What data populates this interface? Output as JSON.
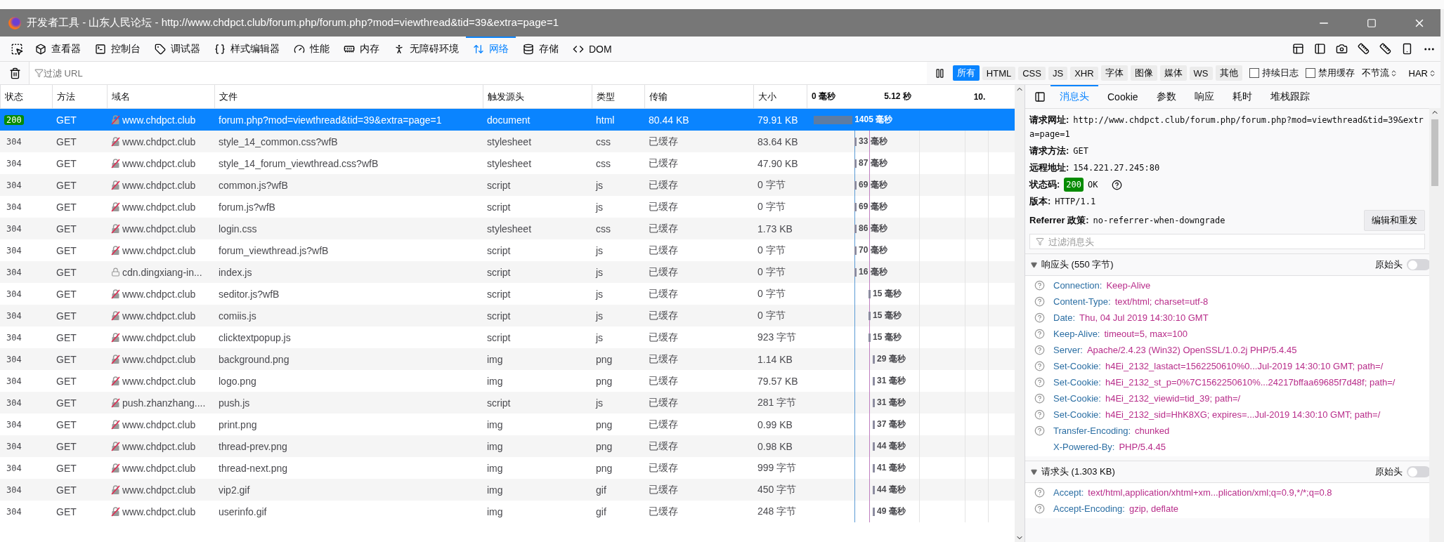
{
  "window": {
    "title": "开发者工具 - 山东人民论坛 - http://www.chdpct.club/forum.php/forum.php?mod=viewthread&tid=39&extra=page=1"
  },
  "tools": [
    {
      "label": "查看器",
      "kind": "inspector",
      "selected": false
    },
    {
      "label": "控制台",
      "kind": "console",
      "selected": false
    },
    {
      "label": "调试器",
      "kind": "debugger",
      "selected": false
    },
    {
      "label": "样式编辑器",
      "kind": "style",
      "selected": false
    },
    {
      "label": "性能",
      "kind": "performance",
      "selected": false
    },
    {
      "label": "内存",
      "kind": "memory",
      "selected": false
    },
    {
      "label": "无障碍环境",
      "kind": "accessibility",
      "selected": false
    },
    {
      "label": "网络",
      "kind": "network",
      "selected": true
    },
    {
      "label": "存储",
      "kind": "storage",
      "selected": false
    },
    {
      "label": "DOM",
      "kind": "dom",
      "selected": false
    }
  ],
  "filter": {
    "placeholder": "过滤 URL"
  },
  "type_filters": [
    {
      "label": "所有",
      "selected": true
    },
    {
      "label": "HTML",
      "selected": false
    },
    {
      "label": "CSS",
      "selected": false
    },
    {
      "label": "JS",
      "selected": false
    },
    {
      "label": "XHR",
      "selected": false
    },
    {
      "label": "字体",
      "selected": false
    },
    {
      "label": "图像",
      "selected": false
    },
    {
      "label": "媒体",
      "selected": false
    },
    {
      "label": "WS",
      "selected": false
    },
    {
      "label": "其他",
      "selected": false
    }
  ],
  "options": [
    {
      "label": "持续日志",
      "checked": false
    },
    {
      "label": "禁用缓存",
      "checked": false
    }
  ],
  "selects": [
    "不节流",
    "HAR"
  ],
  "columns": [
    "状态",
    "方法",
    "域名",
    "文件",
    "触发源头",
    "类型",
    "传输",
    "大小"
  ],
  "timeline_ticks": [
    "0 毫秒",
    "5.12 秒",
    "10."
  ],
  "rows": [
    {
      "status": "200",
      "method": "GET",
      "secure": false,
      "domain": "www.chdpct.club",
      "file": "forum.php?mod=viewthread&tid=39&extra=page=1",
      "cause": "document",
      "type": "html",
      "transferred": "80.44 KB",
      "size": "79.91 KB",
      "time": "1405 毫秒",
      "selected": true
    },
    {
      "status": "304",
      "method": "GET",
      "secure": false,
      "domain": "www.chdpct.club",
      "file": "style_14_common.css?wfB",
      "cause": "stylesheet",
      "type": "css",
      "transferred": "已缓存",
      "size": "83.64 KB",
      "time": "33 毫秒",
      "selected": false
    },
    {
      "status": "304",
      "method": "GET",
      "secure": false,
      "domain": "www.chdpct.club",
      "file": "style_14_forum_viewthread.css?wfB",
      "cause": "stylesheet",
      "type": "css",
      "transferred": "已缓存",
      "size": "47.90 KB",
      "time": "87 毫秒",
      "selected": false
    },
    {
      "status": "304",
      "method": "GET",
      "secure": false,
      "domain": "www.chdpct.club",
      "file": "common.js?wfB",
      "cause": "script",
      "type": "js",
      "transferred": "已缓存",
      "size": "0 字节",
      "time": "69 毫秒",
      "selected": false
    },
    {
      "status": "304",
      "method": "GET",
      "secure": false,
      "domain": "www.chdpct.club",
      "file": "forum.js?wfB",
      "cause": "script",
      "type": "js",
      "transferred": "已缓存",
      "size": "0 字节",
      "time": "69 毫秒",
      "selected": false
    },
    {
      "status": "304",
      "method": "GET",
      "secure": false,
      "domain": "www.chdpct.club",
      "file": "login.css",
      "cause": "stylesheet",
      "type": "css",
      "transferred": "已缓存",
      "size": "1.73 KB",
      "time": "86 毫秒",
      "selected": false
    },
    {
      "status": "304",
      "method": "GET",
      "secure": false,
      "domain": "www.chdpct.club",
      "file": "forum_viewthread.js?wfB",
      "cause": "script",
      "type": "js",
      "transferred": "已缓存",
      "size": "0 字节",
      "time": "70 毫秒",
      "selected": false
    },
    {
      "status": "304",
      "method": "GET",
      "secure": true,
      "domain": "cdn.dingxiang-in...",
      "file": "index.js",
      "cause": "script",
      "type": "js",
      "transferred": "已缓存",
      "size": "0 字节",
      "time": "16 毫秒",
      "selected": false
    },
    {
      "status": "304",
      "method": "GET",
      "secure": false,
      "domain": "www.chdpct.club",
      "file": "seditor.js?wfB",
      "cause": "script",
      "type": "js",
      "transferred": "已缓存",
      "size": "0 字节",
      "time": "15 毫秒",
      "selected": false
    },
    {
      "status": "304",
      "method": "GET",
      "secure": false,
      "domain": "www.chdpct.club",
      "file": "comiis.js",
      "cause": "script",
      "type": "js",
      "transferred": "已缓存",
      "size": "0 字节",
      "time": "15 毫秒",
      "selected": false
    },
    {
      "status": "304",
      "method": "GET",
      "secure": false,
      "domain": "www.chdpct.club",
      "file": "clicktextpopup.js",
      "cause": "script",
      "type": "js",
      "transferred": "已缓存",
      "size": "923 字节",
      "time": "15 毫秒",
      "selected": false
    },
    {
      "status": "304",
      "method": "GET",
      "secure": false,
      "domain": "www.chdpct.club",
      "file": "background.png",
      "cause": "img",
      "type": "png",
      "transferred": "已缓存",
      "size": "1.14 KB",
      "time": "29 毫秒",
      "selected": false
    },
    {
      "status": "304",
      "method": "GET",
      "secure": false,
      "domain": "www.chdpct.club",
      "file": "logo.png",
      "cause": "img",
      "type": "png",
      "transferred": "已缓存",
      "size": "79.57 KB",
      "time": "31 毫秒",
      "selected": false
    },
    {
      "status": "304",
      "method": "GET",
      "secure": false,
      "domain": "push.zhanzhang....",
      "file": "push.js",
      "cause": "script",
      "type": "js",
      "transferred": "已缓存",
      "size": "281 字节",
      "time": "31 毫秒",
      "selected": false
    },
    {
      "status": "304",
      "method": "GET",
      "secure": false,
      "domain": "www.chdpct.club",
      "file": "print.png",
      "cause": "img",
      "type": "png",
      "transferred": "已缓存",
      "size": "0.99 KB",
      "time": "37 毫秒",
      "selected": false
    },
    {
      "status": "304",
      "method": "GET",
      "secure": false,
      "domain": "www.chdpct.club",
      "file": "thread-prev.png",
      "cause": "img",
      "type": "png",
      "transferred": "已缓存",
      "size": "0.98 KB",
      "time": "44 毫秒",
      "selected": false
    },
    {
      "status": "304",
      "method": "GET",
      "secure": false,
      "domain": "www.chdpct.club",
      "file": "thread-next.png",
      "cause": "img",
      "type": "png",
      "transferred": "已缓存",
      "size": "999 字节",
      "time": "41 毫秒",
      "selected": false
    },
    {
      "status": "304",
      "method": "GET",
      "secure": false,
      "domain": "www.chdpct.club",
      "file": "vip2.gif",
      "cause": "img",
      "type": "gif",
      "transferred": "已缓存",
      "size": "450 字节",
      "time": "44 毫秒",
      "selected": false
    },
    {
      "status": "304",
      "method": "GET",
      "secure": false,
      "domain": "www.chdpct.club",
      "file": "userinfo.gif",
      "cause": "img",
      "type": "gif",
      "transferred": "已缓存",
      "size": "248 字节",
      "time": "49 毫秒",
      "selected": false
    }
  ],
  "details": {
    "tabs": [
      {
        "label": "消息头",
        "selected": true
      },
      {
        "label": "Cookie",
        "selected": false
      },
      {
        "label": "参数",
        "selected": false
      },
      {
        "label": "响应",
        "selected": false
      },
      {
        "label": "耗时",
        "selected": false
      },
      {
        "label": "堆栈跟踪",
        "selected": false
      }
    ],
    "summary": [
      {
        "label": "请求网址:",
        "value": "http://www.chdpct.club/forum.php/forum.php?mod=viewthread&tid=39&extra=page=1"
      },
      {
        "label": "请求方法:",
        "value": "GET"
      },
      {
        "label": "远程地址:",
        "value": "154.221.27.245:80"
      }
    ],
    "status": {
      "label": "状态码:",
      "code": "200",
      "text": "OK"
    },
    "version": {
      "label": "版本:",
      "value": "HTTP/1.1"
    },
    "referrer": {
      "label": "Referrer 政策:",
      "value": "no-referrer-when-downgrade"
    },
    "resend_button": "编辑和重发",
    "header_filter": {
      "placeholder": "过滤消息头"
    },
    "sections": [
      {
        "title": "响应头 (550 字节)",
        "expanded": true,
        "raw_label": "原始头",
        "raw_on": false,
        "headers": [
          {
            "name": "Connection:",
            "value": "Keep-Alive",
            "help": true
          },
          {
            "name": "Content-Type:",
            "value": "text/html; charset=utf-8",
            "help": true
          },
          {
            "name": "Date:",
            "value": "Thu, 04 Jul 2019 14:30:10 GMT",
            "help": true
          },
          {
            "name": "Keep-Alive:",
            "value": "timeout=5, max=100",
            "help": true
          },
          {
            "name": "Server:",
            "value": "Apache/2.4.23 (Win32) OpenSSL/1.0.2j PHP/5.4.45",
            "help": true
          },
          {
            "name": "Set-Cookie:",
            "value": "h4Ei_2132_lastact=1562250610%0...Jul-2019 14:30:10 GMT; path=/",
            "help": true
          },
          {
            "name": "Set-Cookie:",
            "value": "h4Ei_2132_st_p=0%7C1562250610%...24217bffaa69685f7d48f; path=/",
            "help": true
          },
          {
            "name": "Set-Cookie:",
            "value": "h4Ei_2132_viewid=tid_39; path=/",
            "help": true
          },
          {
            "name": "Set-Cookie:",
            "value": "h4Ei_2132_sid=HhK8XG; expires=...Jul-2019 14:30:10 GMT; path=/",
            "help": true
          },
          {
            "name": "Transfer-Encoding:",
            "value": "chunked",
            "help": true
          },
          {
            "name": "X-Powered-By:",
            "value": "PHP/5.4.45",
            "help": false
          }
        ]
      },
      {
        "title": "请求头 (1.303 KB)",
        "expanded": true,
        "raw_label": "原始头",
        "raw_on": false,
        "headers": [
          {
            "name": "Accept:",
            "value": "text/html,application/xhtml+xm...plication/xml;q=0.9,*/*;q=0.8",
            "help": true
          },
          {
            "name": "Accept-Encoding:",
            "value": "gzip, deflate",
            "help": true
          }
        ]
      }
    ]
  }
}
